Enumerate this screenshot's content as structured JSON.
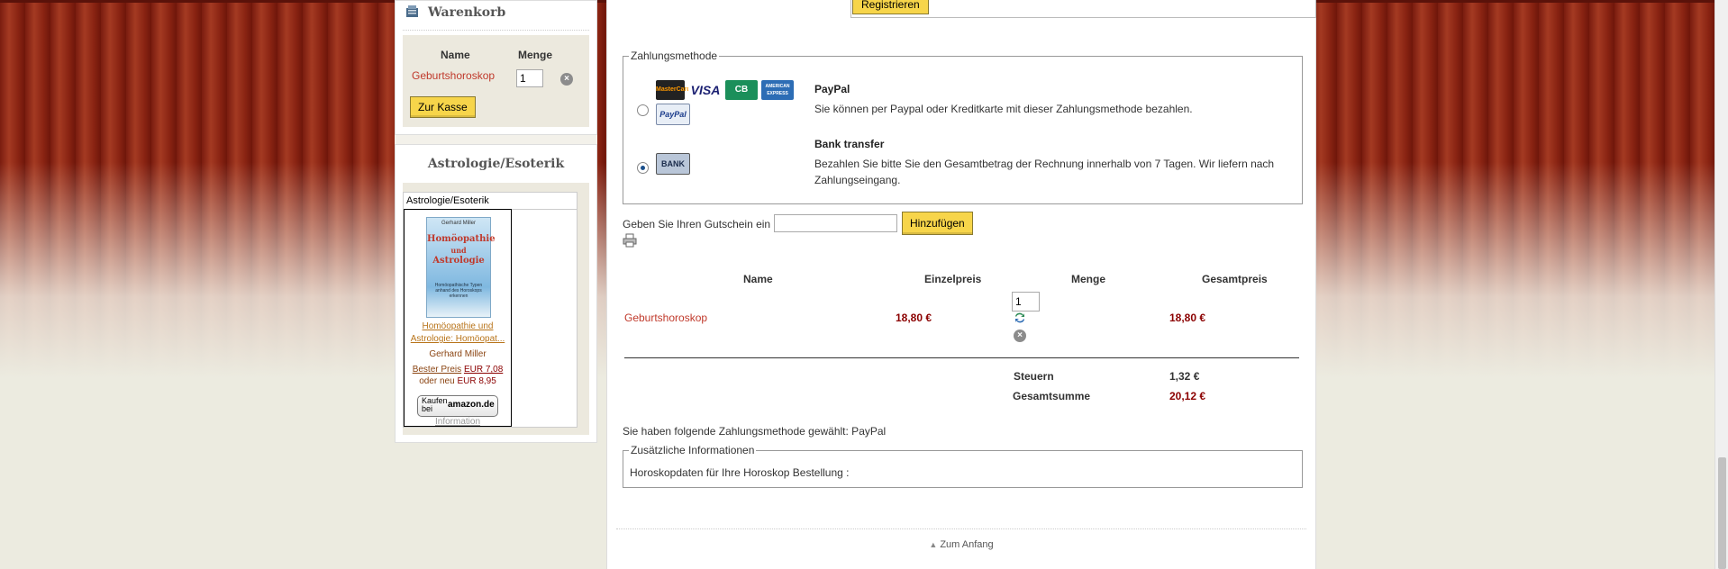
{
  "cart": {
    "title": "Warenkorb",
    "col_name": "Name",
    "col_qty": "Menge",
    "item_name": "Geburtshoroskop",
    "item_qty": "1",
    "checkout_label": "Zur Kasse"
  },
  "astro": {
    "title": "Astrologie/Esoterik",
    "widget_header": "Astrologie/Esoterik",
    "book_cover_author": "Gerhard Miller",
    "book_cover_title_1": "Homöopathie",
    "book_cover_title_2": "und",
    "book_cover_title_3": "Astrologie",
    "book_cover_subtitle": "Homöopathische Typen anhand des Horoskops erkennen",
    "book_link_1": "Homöopathie und",
    "book_link_2": "Astrologie: Homöopat...",
    "author": "Gerhard Miller",
    "best_price_label": "Bester Preis",
    "best_price_value": "EUR 7,08",
    "new_price_label": "oder neu",
    "new_price_value": "EUR 8,95",
    "amazon_buy": "Kaufen bei",
    "amazon_brand": "amazon.de",
    "info_link": "Information"
  },
  "register_label": "Registrieren",
  "payment": {
    "legend": "Zahlungsmethode",
    "options": [
      {
        "title": "PayPal",
        "description": "Sie können per Paypal oder Kreditkarte mit dieser Zahlungsmethode bezahlen.",
        "selected": false
      },
      {
        "title": "Bank transfer",
        "description": "Bezahlen Sie bitte Sie den Gesamtbetrag der Rechnung innerhalb von 7 Tagen. Wir liefern nach Zahlungseingang.",
        "selected": true
      }
    ],
    "card_logos": {
      "mastercard": "MasterCard",
      "visa": "VISA",
      "cb": "CB",
      "amex": "AMERICAN EXPRESS",
      "paypal": "PayPal",
      "bank": "BANK"
    }
  },
  "coupon": {
    "label": "Geben Sie Ihren Gutschein ein",
    "value": "",
    "button_label": "Hinzufügen"
  },
  "order_table": {
    "headers": [
      "Name",
      "Einzelpreis",
      "Menge",
      "Gesamtpreis"
    ],
    "rows": [
      {
        "name": "Geburtshoroskop",
        "unit_price": "18,80 €",
        "qty": "1",
        "total": "18,80 €"
      }
    ],
    "tax_label": "Steuern",
    "tax_value": "1,32 €",
    "grand_total_label": "Gesamtsumme",
    "grand_total_value": "20,12 €"
  },
  "chosen_payment_text": "Sie haben folgende Zahlungsmethode gewählt: PayPal",
  "extra_info": {
    "legend": "Zusätzliche Informationen",
    "text": "Horoskopdaten für Ihre Horoskop Bestellung :"
  },
  "to_top_label": "Zum Anfang",
  "colors": {
    "accent_button": "#f7d54a",
    "link_red": "#c0392b",
    "price_red": "#8b0000"
  }
}
